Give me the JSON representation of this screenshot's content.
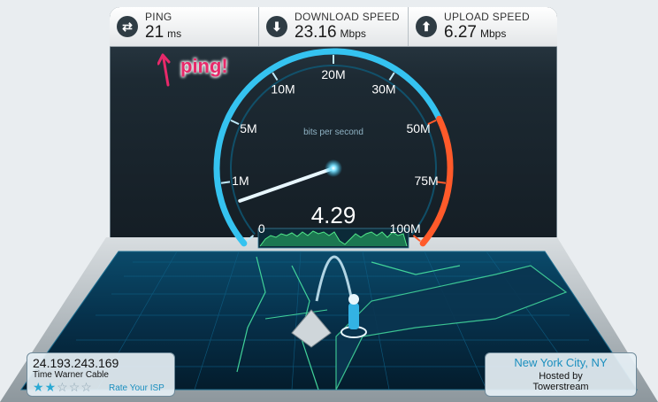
{
  "stats": {
    "ping": {
      "label": "PING",
      "value": "21",
      "unit": "ms",
      "icon": "ping-arrows-icon"
    },
    "download": {
      "label": "DOWNLOAD SPEED",
      "value": "23.16",
      "unit": "Mbps",
      "icon": "download-arrow-icon"
    },
    "upload": {
      "label": "UPLOAD SPEED",
      "value": "6.27",
      "unit": "Mbps",
      "icon": "upload-arrow-icon"
    }
  },
  "annotation": {
    "text": "ping!",
    "color": "#e8296a"
  },
  "gauge": {
    "scale_labels": [
      "0",
      "1M",
      "5M",
      "10M",
      "20M",
      "30M",
      "50M",
      "75M",
      "100M"
    ],
    "caption": "bits per second",
    "current_value": "4.29",
    "needle_level_fraction": 0.08,
    "accent_color": "#35c3f0",
    "warn_color": "#ff5a2a"
  },
  "isp": {
    "ip": "24.193.243.169",
    "name": "Time Warner Cable",
    "rating": 2,
    "rating_max": 5,
    "rate_label": "Rate Your ISP"
  },
  "server": {
    "city": "New York City, NY",
    "hosted_by": "Hosted by",
    "host": "Towerstream"
  }
}
